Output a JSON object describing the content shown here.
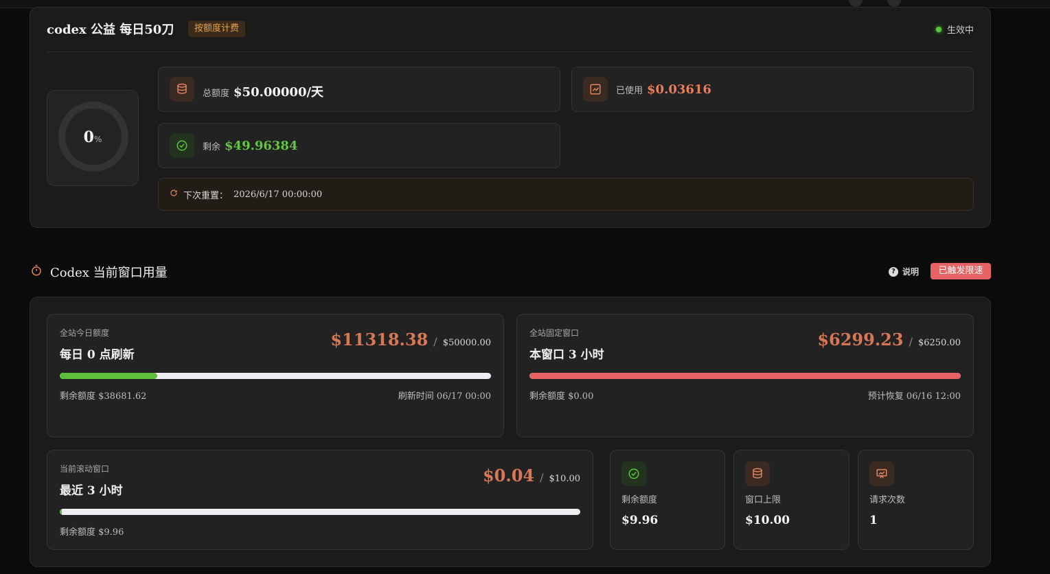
{
  "plan": {
    "title": "codex 公益 每日50刀",
    "billing_tag": "按额度计费",
    "status": "生效中",
    "usage_percent": "0",
    "percent_sign": "%",
    "total_label": "总额度",
    "total_value": "$50.00000/天",
    "used_label": "已使用",
    "used_value": "$0.03616",
    "remaining_label": "剩余",
    "remaining_value": "$49.96384",
    "reset_label": "下次重置：",
    "reset_time": "2026/6/17 00:00:00"
  },
  "section": {
    "title": "Codex 当前窗口用量",
    "help_label": "说明",
    "limit_badge": "已触发限速"
  },
  "daily": {
    "label": "全站今日额度",
    "title": "每日 0 点刷新",
    "used": "$11318.38",
    "separator": "/",
    "total": "$50000.00",
    "progress": 0.2264,
    "remaining": "剩余额度 $38681.62",
    "refresh": "刷新时间 06/17 00:00"
  },
  "fixed": {
    "label": "全站固定窗口",
    "title": "本窗口 3 小时",
    "used": "$6299.23",
    "separator": "/",
    "total": "$6250.00",
    "progress": 1.0,
    "remaining": "剩余额度 $0.00",
    "recover": "预计恢复 06/16 12:00"
  },
  "rolling": {
    "label": "当前滚动窗口",
    "title": "最近 3 小时",
    "used": "$0.04",
    "separator": "/",
    "total": "$10.00",
    "progress": 0.004,
    "remaining": "剩余额度 $9.96"
  },
  "mini_stats": [
    {
      "label": "剩余额度",
      "value": "$9.96",
      "icon": "check-circle-icon"
    },
    {
      "label": "窗口上限",
      "value": "$10.00",
      "icon": "database-icon"
    },
    {
      "label": "请求次数",
      "value": "1",
      "icon": "presentation-chart-icon"
    }
  ],
  "colors": {
    "accent_orange": "#d77756",
    "green": "#62c640",
    "red": "#e76262"
  }
}
